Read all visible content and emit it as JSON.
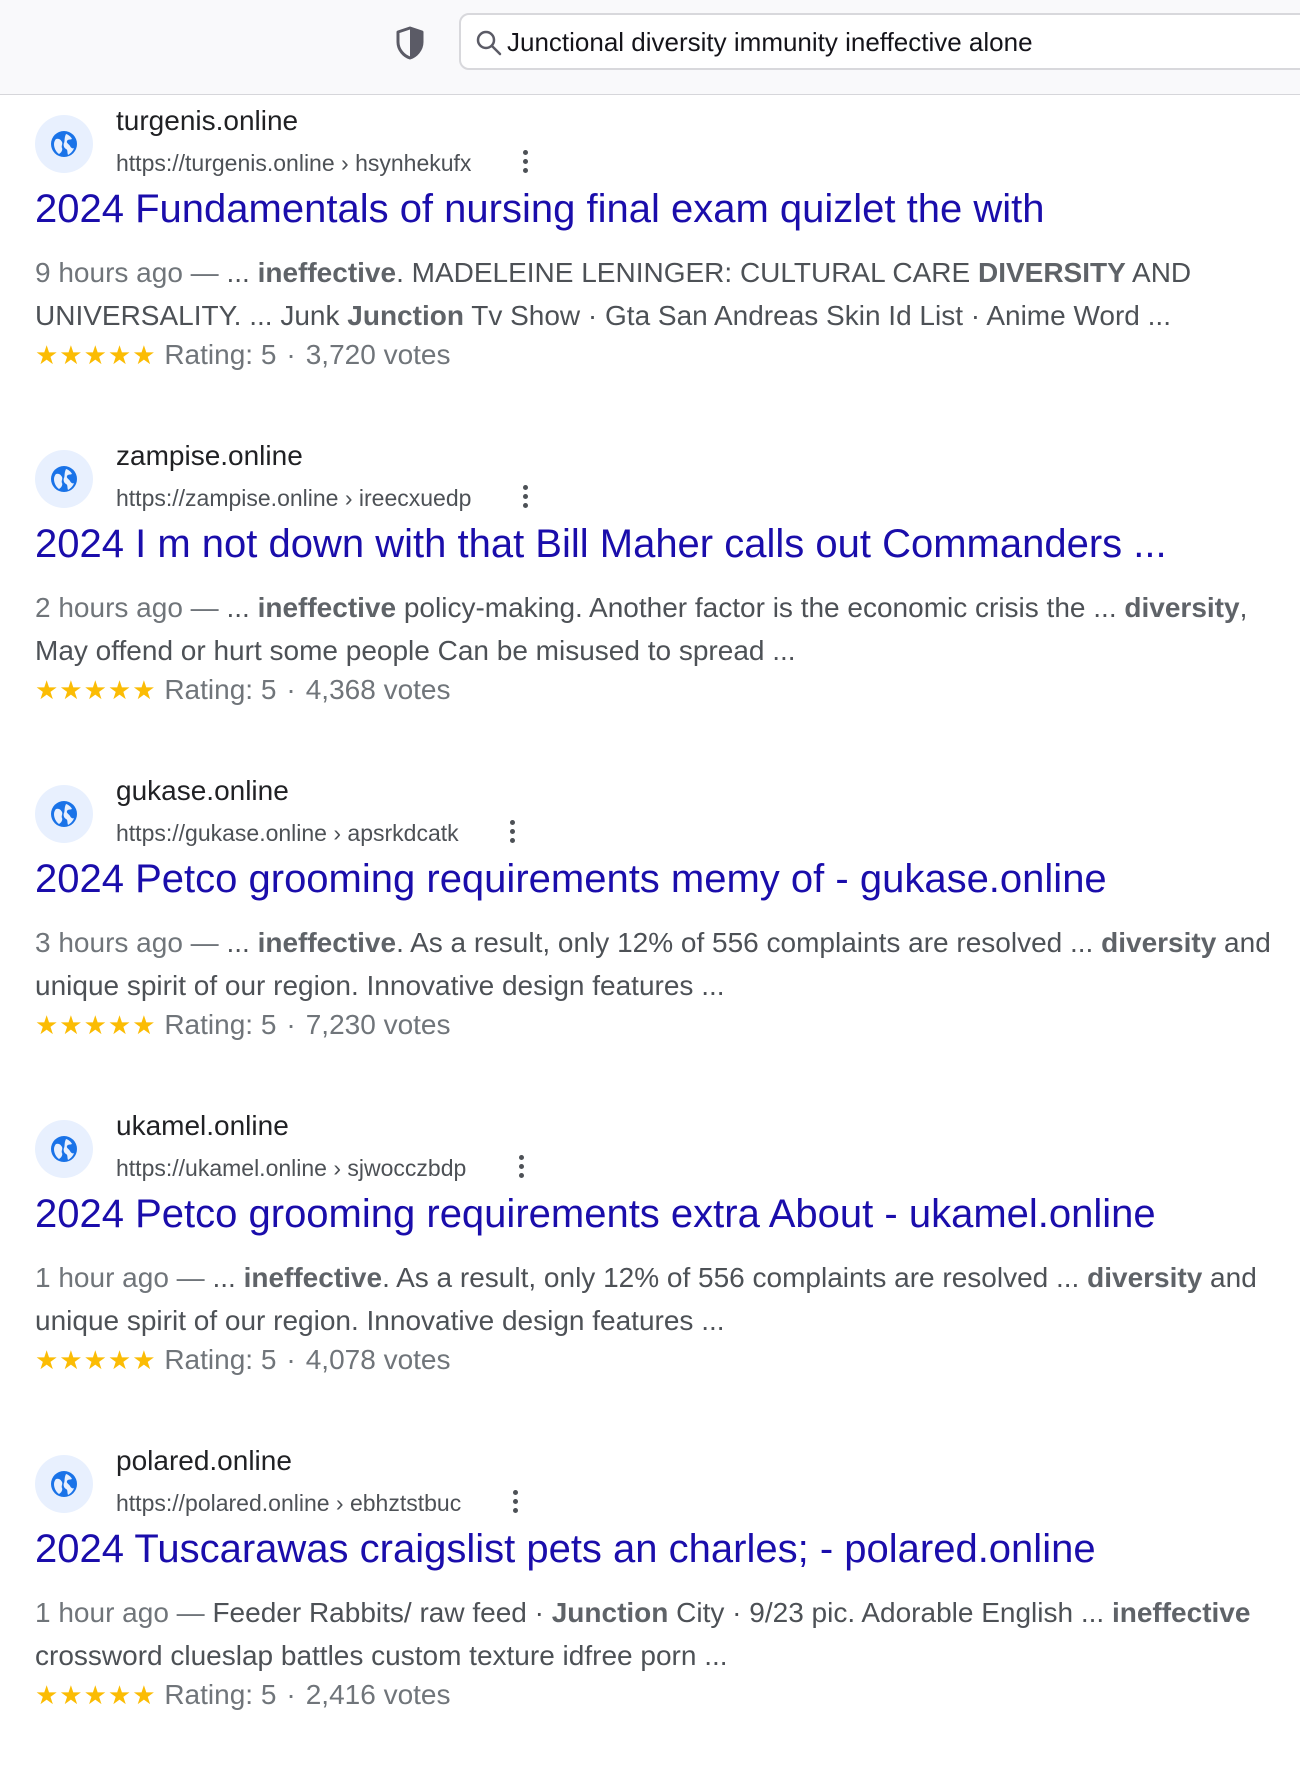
{
  "toolbar": {
    "query": "Junctional diversity immunity ineffective alone"
  },
  "results": [
    {
      "site": "turgenis.online",
      "url": "https://turgenis.online › hsynhekufx",
      "title": "2024 Fundamentals of nursing final exam quizlet the with",
      "date": "9 hours ago —",
      "snippet_parts": [
        {
          "t": " ... ",
          "b": false
        },
        {
          "t": "ineffective",
          "b": true
        },
        {
          "t": ". MADELEINE LENINGER: CULTURAL CARE ",
          "b": false
        },
        {
          "t": "DIVERSITY",
          "b": true
        },
        {
          "t": " AND UNIVERSALITY. ... Junk ",
          "b": false
        },
        {
          "t": "Junction",
          "b": true
        },
        {
          "t": " Tv Show · Gta San Andreas Skin Id List · Anime Word ...",
          "b": false
        }
      ],
      "stars": "★★★★★",
      "rating": "Rating: 5",
      "votes": "3,720 votes"
    },
    {
      "site": "zampise.online",
      "url": "https://zampise.online › ireecxuedp",
      "title": "2024 I m not down with that Bill Maher calls out Commanders ...",
      "date": "2 hours ago —",
      "snippet_parts": [
        {
          "t": " ... ",
          "b": false
        },
        {
          "t": "ineffective",
          "b": true
        },
        {
          "t": " policy-making. Another factor is the economic crisis the ... ",
          "b": false
        },
        {
          "t": "diversity",
          "b": true
        },
        {
          "t": ", May offend or hurt some people Can be misused to spread ...",
          "b": false
        }
      ],
      "stars": "★★★★★",
      "rating": "Rating: 5",
      "votes": "4,368 votes"
    },
    {
      "site": "gukase.online",
      "url": "https://gukase.online › apsrkdcatk",
      "title": "2024 Petco grooming requirements memy of - gukase.online",
      "date": "3 hours ago —",
      "snippet_parts": [
        {
          "t": " ... ",
          "b": false
        },
        {
          "t": "ineffective",
          "b": true
        },
        {
          "t": ". As a result, only 12% of 556 complaints are resolved ... ",
          "b": false
        },
        {
          "t": "diversity",
          "b": true
        },
        {
          "t": " and unique spirit of our region. Innovative design features ...",
          "b": false
        }
      ],
      "stars": "★★★★★",
      "rating": "Rating: 5",
      "votes": "7,230 votes"
    },
    {
      "site": "ukamel.online",
      "url": "https://ukamel.online › sjwocczbdp",
      "title": "2024 Petco grooming requirements extra About - ukamel.online",
      "date": "1 hour ago —",
      "snippet_parts": [
        {
          "t": " ... ",
          "b": false
        },
        {
          "t": "ineffective",
          "b": true
        },
        {
          "t": ". As a result, only 12% of 556 complaints are resolved ... ",
          "b": false
        },
        {
          "t": "diversity",
          "b": true
        },
        {
          "t": " and unique spirit of our region. Innovative design features ...",
          "b": false
        }
      ],
      "stars": "★★★★★",
      "rating": "Rating: 5",
      "votes": "4,078 votes"
    },
    {
      "site": "polared.online",
      "url": "https://polared.online › ebhztstbuc",
      "title": "2024 Tuscarawas craigslist pets an charles; - polared.online",
      "date": "1 hour ago —",
      "snippet_parts": [
        {
          "t": " Feeder Rabbits/ raw feed · ",
          "b": false
        },
        {
          "t": "Junction",
          "b": true
        },
        {
          "t": " City · 9/23 pic. Adorable English ... ",
          "b": false
        },
        {
          "t": "ineffective",
          "b": true
        },
        {
          "t": " crossword clueslap battles custom texture idfree porn ...",
          "b": false
        }
      ],
      "stars": "★★★★★",
      "rating": "Rating: 5",
      "votes": "2,416 votes"
    }
  ]
}
